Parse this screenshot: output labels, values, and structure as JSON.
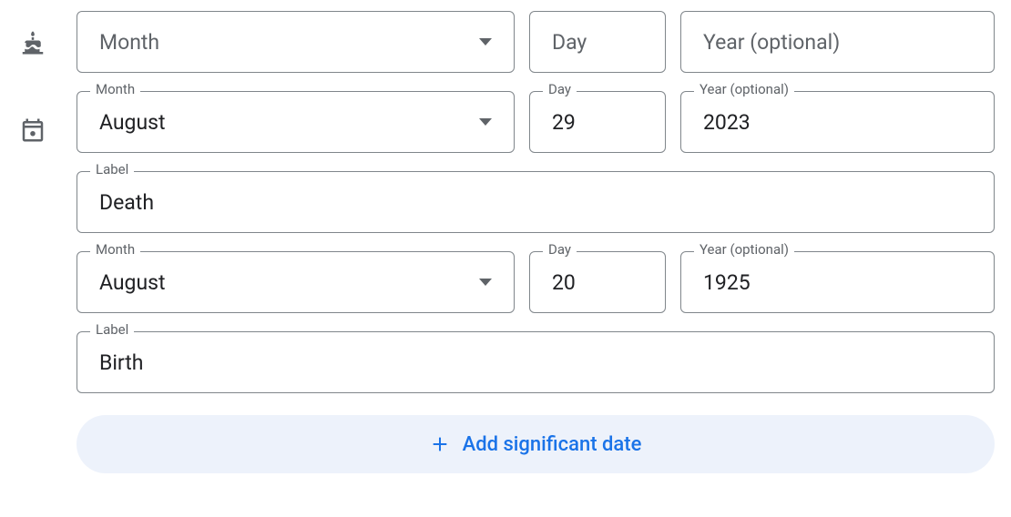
{
  "birthday": {
    "monthPlaceholder": "Month",
    "dayPlaceholder": "Day",
    "yearPlaceholder": "Year (optional)",
    "month": "",
    "day": "",
    "year": ""
  },
  "events": [
    {
      "monthLabel": "Month",
      "dayLabel": "Day",
      "yearLabel": "Year (optional)",
      "labelLabel": "Label",
      "month": "August",
      "day": "29",
      "year": "2023",
      "label": "Death"
    },
    {
      "monthLabel": "Month",
      "dayLabel": "Day",
      "yearLabel": "Year (optional)",
      "labelLabel": "Label",
      "month": "August",
      "day": "20",
      "year": "1925",
      "label": "Birth"
    }
  ],
  "addButton": "Add significant date"
}
